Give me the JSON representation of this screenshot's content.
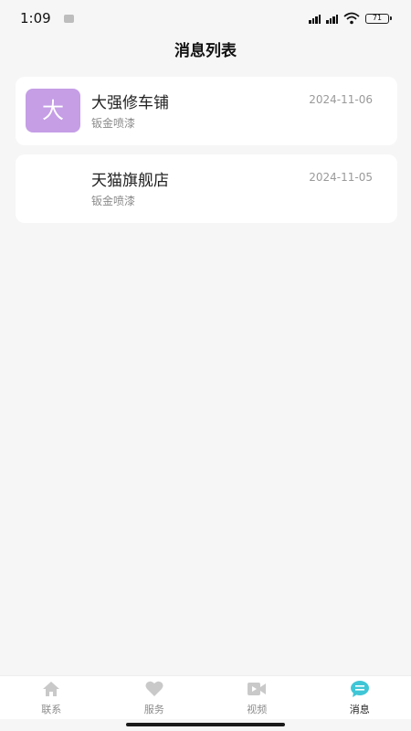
{
  "status_bar": {
    "time": "1:09",
    "battery": "71"
  },
  "header": {
    "title": "消息列表"
  },
  "messages": [
    {
      "avatar_text": "大",
      "name": "大强修车铺",
      "subtitle": "钣金喷漆",
      "date": "2024-11-06"
    },
    {
      "avatar_text": "",
      "name": "天猫旗舰店",
      "subtitle": "钣金喷漆",
      "date": "2024-11-05"
    }
  ],
  "tabbar": {
    "items": [
      {
        "label": "联系",
        "icon": "home-icon",
        "active": false
      },
      {
        "label": "服务",
        "icon": "heart-icon",
        "active": false
      },
      {
        "label": "视频",
        "icon": "video-icon",
        "active": false
      },
      {
        "label": "消息",
        "icon": "message-icon",
        "active": true
      }
    ]
  },
  "colors": {
    "accent": "#3fc6d6",
    "avatar": "#c59ee6",
    "inactive_icon": "#c9c9c9"
  }
}
